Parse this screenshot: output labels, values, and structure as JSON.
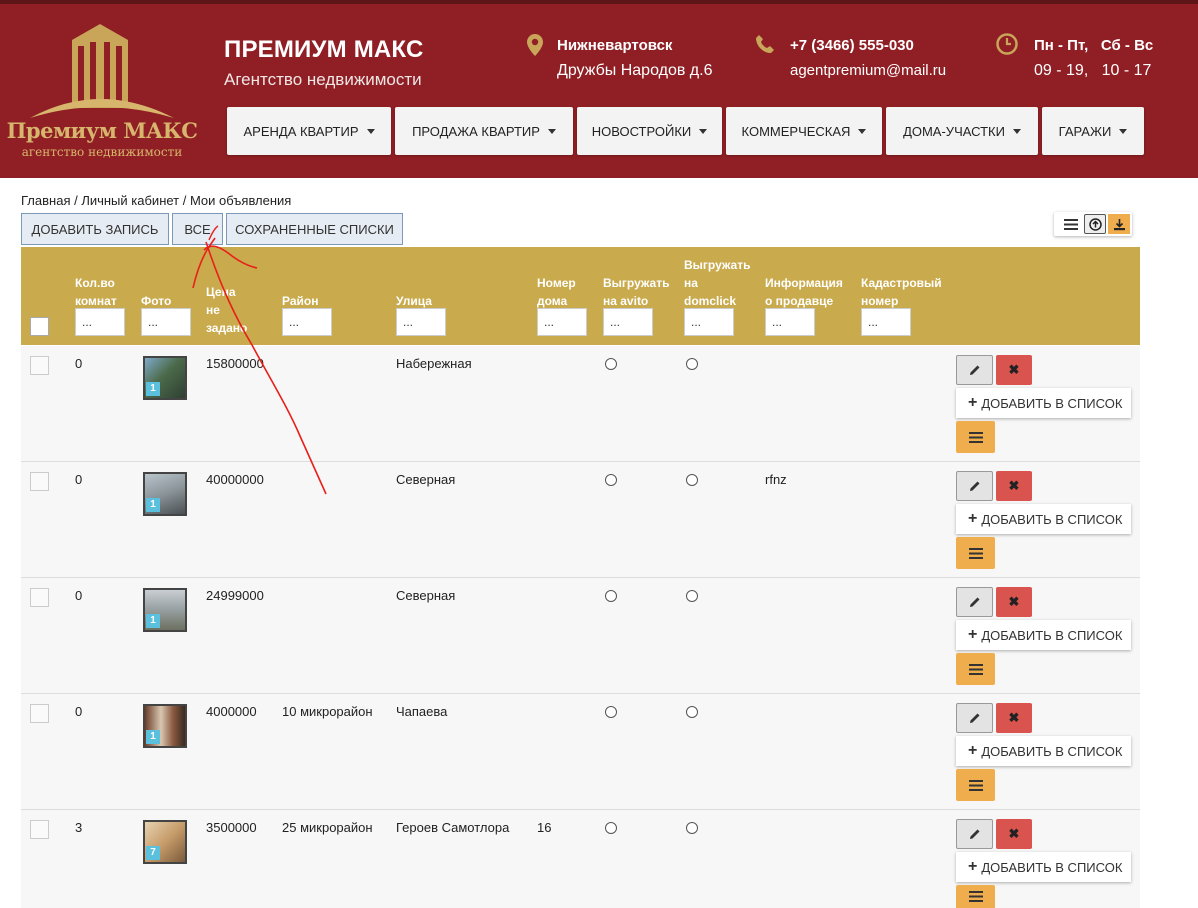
{
  "brand": {
    "title": "ПРЕМИУМ МАКС",
    "subtitle": "Агентство недвижимости",
    "logo_name": "Премиум МАКС",
    "logo_sub": "агентство недвижимости"
  },
  "contacts": {
    "city": "Нижневартовск",
    "address": "Дружбы Народов д.6",
    "phone": "+7 (3466) 555-030",
    "email": "agentpremium@mail.ru",
    "days": "Пн - Пт,   Сб - Вс",
    "hours": "09 - 19,   10 - 17"
  },
  "nav": [
    "АРЕНДА КВАРТИР",
    "ПРОДАЖА КВАРТИР",
    "НОВОСТРОЙКИ",
    "КОММЕРЧЕСКАЯ",
    "ДОМА-УЧАСТКИ",
    "ГАРАЖИ"
  ],
  "breadcrumb": "Главная / Личный кабинет / Мои объявления",
  "toolbar": {
    "add": "ДОБАВИТЬ ЗАПИСЬ",
    "all": "ВСЕ",
    "saved": "СОХРАНЕННЫЕ СПИСКИ"
  },
  "table": {
    "headers": {
      "rooms": [
        "Кол.во",
        "комнат"
      ],
      "photo": [
        "Фото"
      ],
      "price": [
        "Цена",
        "не",
        "задано"
      ],
      "district": [
        "Район"
      ],
      "street": [
        "Улица"
      ],
      "house": [
        "Номер",
        "дома"
      ],
      "avito": [
        "Выгружать",
        "на avito"
      ],
      "domclick": [
        "Выгружать",
        "на",
        "domclick"
      ],
      "seller": [
        "Информация",
        "о продавце"
      ],
      "cadastre": [
        "Кадастровый",
        "номер"
      ]
    },
    "filter_placeholder": "...",
    "rows": [
      {
        "rooms": "0",
        "photos": "1",
        "price": "15800000",
        "district": "",
        "street": "Набережная",
        "house": "",
        "seller": ""
      },
      {
        "rooms": "0",
        "photos": "1",
        "price": "40000000",
        "district": "",
        "street": "Северная",
        "house": "",
        "seller": "rfnz"
      },
      {
        "rooms": "0",
        "photos": "1",
        "price": "24999000",
        "district": "",
        "street": "Северная",
        "house": "",
        "seller": ""
      },
      {
        "rooms": "0",
        "photos": "1",
        "price": "4000000",
        "district": "10 микрорайон",
        "street": "Чапаева",
        "house": "",
        "seller": ""
      },
      {
        "rooms": "3",
        "photos": "7",
        "price": "3500000",
        "district": "25 микрорайон",
        "street": "Героев Самотлора",
        "house": "16",
        "seller": ""
      }
    ],
    "add_to_list": "ДОБАВИТЬ В СПИСОК",
    "delete_glyph": "✖"
  },
  "colors": {
    "header_bg": "#8f1f24",
    "gold": "#c9aa4c",
    "danger": "#d9534f",
    "warning": "#f0ad4e",
    "info": "#5bc0de",
    "annotation": "#e8201a"
  }
}
